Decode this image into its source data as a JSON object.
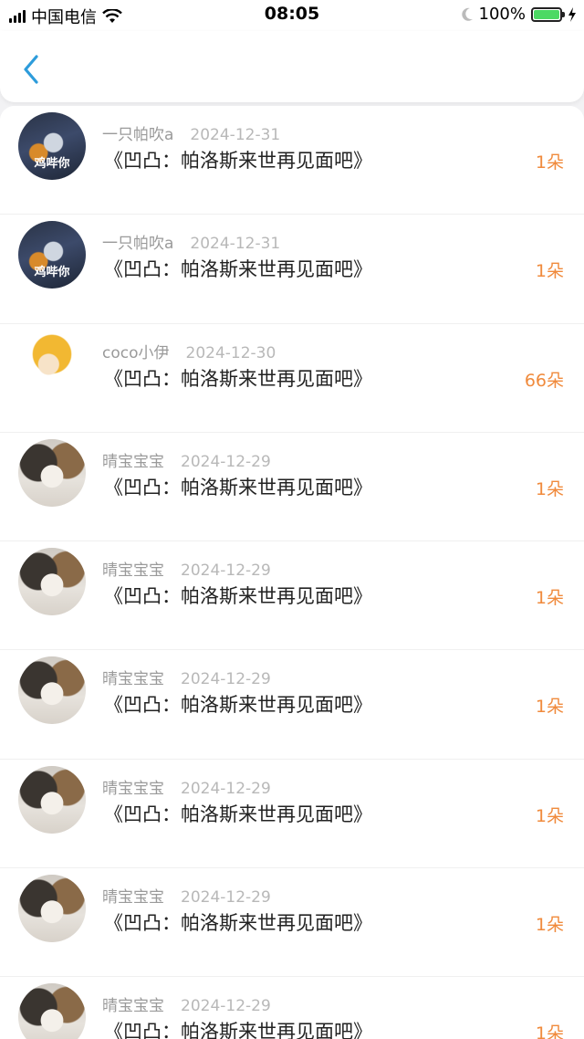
{
  "status_bar": {
    "carrier": "中国电信",
    "time": "08:05",
    "battery": "100%",
    "battery_level": 1.0
  },
  "nav": {
    "back_icon": "chevron-left-icon",
    "accent_color": "#2d9cdb"
  },
  "rows": [
    {
      "user": "一只帕吹a",
      "date": "2024-12-31",
      "title": "《凹凸：帕洛斯来世再见面吧》",
      "count": "1朵",
      "avatar": "hero",
      "avatar_tag": "鸡哔你"
    },
    {
      "user": "一只帕吹a",
      "date": "2024-12-31",
      "title": "《凹凸：帕洛斯来世再见面吧》",
      "count": "1朵",
      "avatar": "hero",
      "avatar_tag": "鸡哔你"
    },
    {
      "user": "coco小伊",
      "date": "2024-12-30",
      "title": "《凹凸：帕洛斯来世再见面吧》",
      "count": "66朵",
      "avatar": "anime",
      "avatar_tag": ""
    },
    {
      "user": "晴宝宝宝",
      "date": "2024-12-29",
      "title": "《凹凸：帕洛斯来世再见面吧》",
      "count": "1朵",
      "avatar": "cat",
      "avatar_tag": ""
    },
    {
      "user": "晴宝宝宝",
      "date": "2024-12-29",
      "title": "《凹凸：帕洛斯来世再见面吧》",
      "count": "1朵",
      "avatar": "cat",
      "avatar_tag": ""
    },
    {
      "user": "晴宝宝宝",
      "date": "2024-12-29",
      "title": "《凹凸：帕洛斯来世再见面吧》",
      "count": "1朵",
      "avatar": "cat",
      "avatar_tag": ""
    },
    {
      "user": "晴宝宝宝",
      "date": "2024-12-29",
      "title": "《凹凸：帕洛斯来世再见面吧》",
      "count": "1朵",
      "avatar": "cat",
      "avatar_tag": ""
    },
    {
      "user": "晴宝宝宝",
      "date": "2024-12-29",
      "title": "《凹凸：帕洛斯来世再见面吧》",
      "count": "1朵",
      "avatar": "cat",
      "avatar_tag": ""
    },
    {
      "user": "晴宝宝宝",
      "date": "2024-12-29",
      "title": "《凹凸：帕洛斯来世再见面吧》",
      "count": "1朵",
      "avatar": "cat",
      "avatar_tag": ""
    }
  ]
}
